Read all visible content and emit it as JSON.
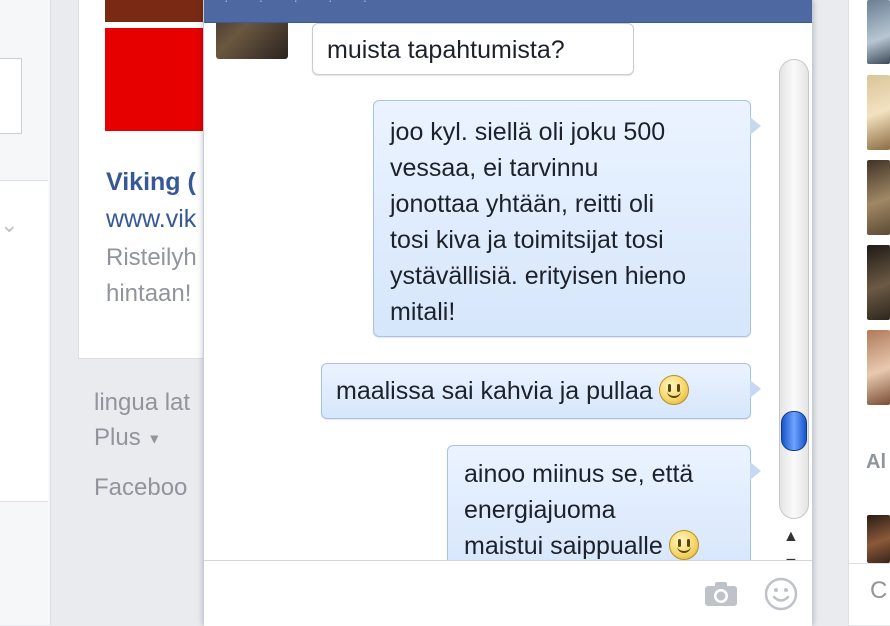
{
  "ad": {
    "title": "Viking (",
    "url": "www.vik",
    "description": "Risteilyh\nhintaan!"
  },
  "footer": {
    "language": "lingua lat",
    "plus": "Plus",
    "facebook": "Faceboo"
  },
  "right_rail": {
    "section_label": "Al",
    "search_glyph": "C"
  },
  "chat": {
    "messages": [
      {
        "direction": "incoming",
        "text": "muista tapahtumista?"
      },
      {
        "direction": "outgoing",
        "text": "joo kyl. siellä oli joku 500\nvessaa, ei tarvinnu\njonottaa yhtään, reitti oli\ntosi kiva ja toimitsijat tosi\nystävällisiä. erityisen hieno\nmitali!"
      },
      {
        "direction": "outgoing",
        "text": "maalissa sai kahvia ja pullaa",
        "emoji": "smiley"
      },
      {
        "direction": "outgoing",
        "text": "ainoo miinus se, että\nenergiajuoma\nmaistui saippualle",
        "emoji": "smiley"
      }
    ],
    "composer": {
      "value": "",
      "placeholder": ""
    },
    "icons": {
      "camera": "camera-icon",
      "emoji": "emoji-icon",
      "scroll_up": "scroll-up-arrow-icon",
      "scroll_down": "scroll-down-arrow-icon"
    }
  },
  "colors": {
    "header": "#4e69a2",
    "link": "#365899",
    "outgoing_bubble": "#d6e6fb",
    "scroll_thumb": "#1a55c9",
    "ad_red": "#e60000"
  }
}
